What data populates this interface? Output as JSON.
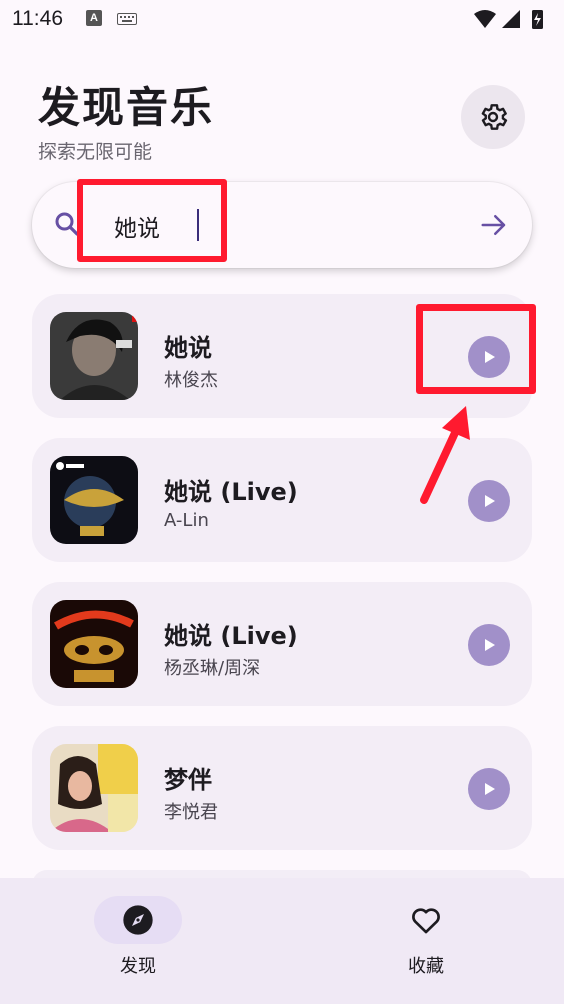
{
  "status_bar": {
    "time": "11:46",
    "input_badge": "A"
  },
  "header": {
    "title": "发现音乐",
    "subtitle": "探索无限可能"
  },
  "search": {
    "value": "她说"
  },
  "songs": [
    {
      "title": "她说",
      "artist": "林俊杰"
    },
    {
      "title": "她说 (Live)",
      "artist": "A-Lin"
    },
    {
      "title": "她说 (Live)",
      "artist": "杨丞琳/周深"
    },
    {
      "title": "梦伴",
      "artist": "李悦君"
    }
  ],
  "nav": {
    "discover_label": "发现",
    "favorites_label": "收藏"
  },
  "colors": {
    "accent": "#a190c9",
    "highlight": "#ff1a2f",
    "search_icon": "#6750a4"
  }
}
